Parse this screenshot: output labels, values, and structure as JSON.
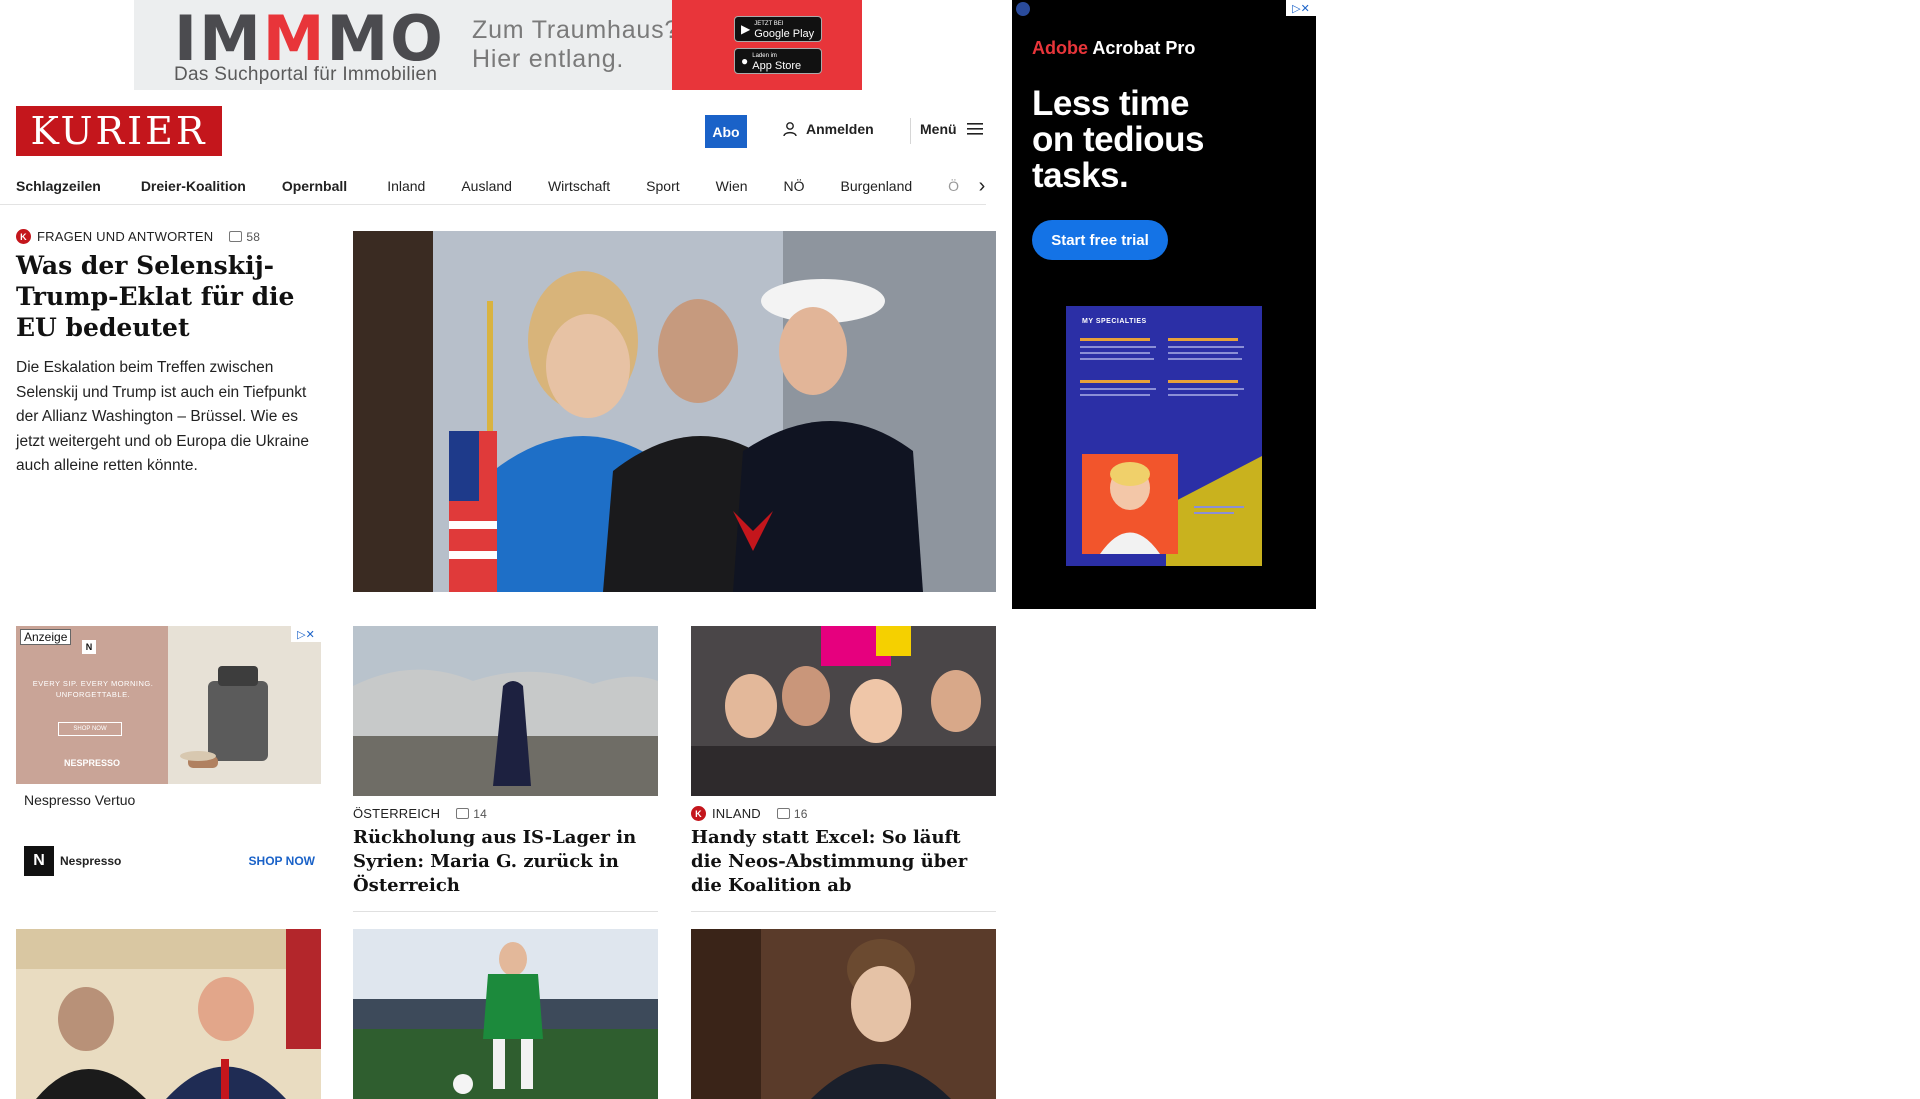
{
  "top_ad": {
    "logo_pre": "IM",
    "logo_hl": "M",
    "logo_post": "MO",
    "subtitle": "Das Suchportal für Immobilien",
    "slogan_line1": "Zum Traumhaus?",
    "slogan_line2": "Hier entlang.",
    "google_play_small": "JETZT BEI",
    "google_play": "Google Play",
    "app_store_small": "Laden im",
    "app_store": "App Store"
  },
  "header": {
    "brand": "KURIER",
    "abo": "Abo",
    "login": "Anmelden",
    "menu": "Menü"
  },
  "nav": {
    "items": [
      "Schlagzeilen",
      "Dreier-Koalition",
      "Opernball",
      "Inland",
      "Ausland",
      "Wirtschaft",
      "Sport",
      "Wien",
      "NÖ",
      "Burgenland",
      "Ö"
    ]
  },
  "lead": {
    "kicker": "FRAGEN UND ANTWORTEN",
    "comments": "58",
    "title": "Was der Selenskij-Trump-Eklat für die EU bedeutet",
    "text": "Die Eskalation beim Treffen zwischen Selenskij und Trump ist auch ein Tiefpunkt der Allianz Washington – Brüssel. Wie es jetzt weitergeht und ob Europa die Ukraine auch alleine retten könnte."
  },
  "ad_nespresso": {
    "label": "Anzeige",
    "tagline": "EVERY SIP. EVERY MORNING. UNFORGETTABLE.",
    "shop_small": "SHOP NOW",
    "brand_img": "NESPRESSO",
    "name": "Nespresso Vertuo",
    "brand": "Nespresso",
    "cta": "SHOP NOW"
  },
  "cards": [
    {
      "kicker": "ÖSTERREICH",
      "comments": "14",
      "title": "Rückholung aus IS-Lager in Syrien: Maria G. zurück in Österreich"
    },
    {
      "kicker": "INLAND",
      "comments": "16",
      "title": "Handy statt Excel: So läuft die Neos-Abstimmung über die Koalition ab"
    }
  ],
  "right_ad": {
    "brand_red": "Adobe",
    "brand": "Acrobat Pro",
    "headline_l1": "Less time",
    "headline_l2": "on tedious",
    "headline_l3": "tasks.",
    "cta": "Start free trial",
    "doc_title": "MY SPECIALTIES"
  },
  "colors": {
    "kurier_red": "#c4161c",
    "accent_blue": "#1a62c8",
    "adobe_blue": "#1473e6"
  }
}
